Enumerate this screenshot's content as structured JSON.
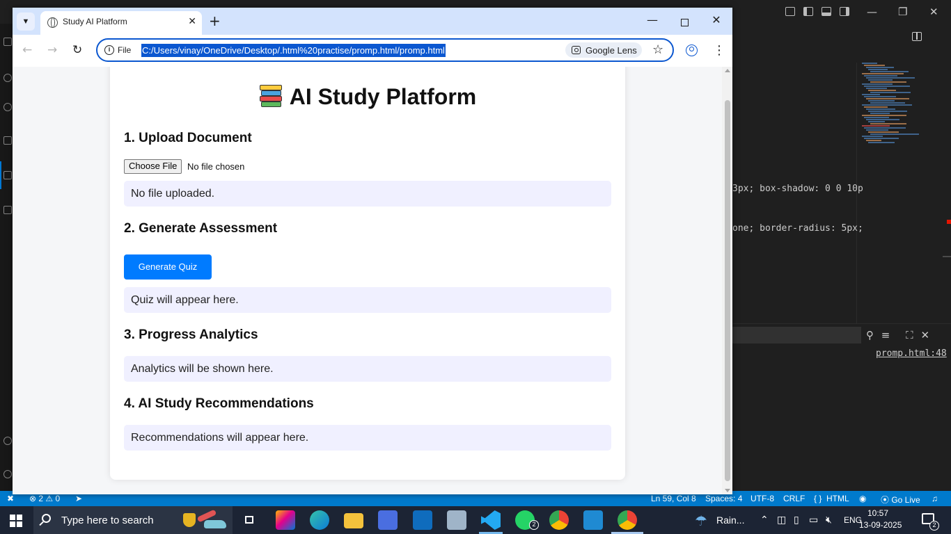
{
  "browser": {
    "tab_title": "Study AI Platform",
    "new_tab": "+",
    "address_prefix": "File",
    "url": "C:/Users/vinay/OneDrive/Desktop/.html%20practise/promp.html/promp.html",
    "lens_label": "Google Lens"
  },
  "page": {
    "title": "AI Study Platform",
    "upload": {
      "heading": "1. Upload Document",
      "choose_file_label": "Choose File",
      "no_file_chosen": "No file chosen",
      "status": "No file uploaded."
    },
    "assessment": {
      "heading": "2. Generate Assessment",
      "button_label": "Generate Quiz",
      "output": "Quiz will appear here."
    },
    "analytics": {
      "heading": "3. Progress Analytics",
      "output": "Analytics will be shown here."
    },
    "recommendations": {
      "heading": "4. AI Study Recommendations",
      "output": "Recommendations will appear here."
    }
  },
  "editor": {
    "code_line_1": "3px; box-shadow: 0 0 10p",
    "code_line_2": "one; border-radius: 5px;",
    "panel_link": "promp.html:48",
    "status": {
      "errors": "2",
      "warnings": "0",
      "position": "Ln 59, Col 8",
      "spaces": "Spaces: 4",
      "encoding": "UTF-8",
      "eol": "CRLF",
      "language": "HTML",
      "go_live": "Go Live"
    }
  },
  "taskbar": {
    "search_placeholder": "Type here to search",
    "weather": "Rain...",
    "language": "ENG",
    "time": "10:57",
    "date": "13-09-2025",
    "whatsapp_badge": "2",
    "notification_badge": "2"
  },
  "colors": {
    "accent": "#0b57d0",
    "button_primary": "#007bff",
    "result_box": "#f0f0ff",
    "vscode_status": "#007acc"
  }
}
